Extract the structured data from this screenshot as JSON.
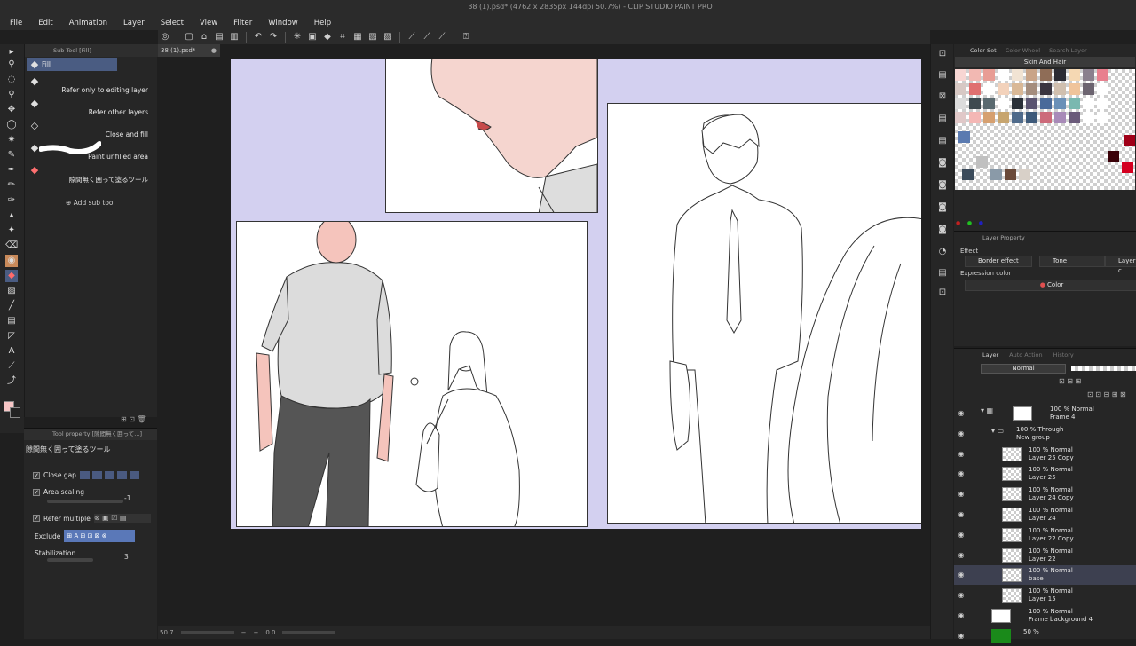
{
  "window": {
    "title": "38 (1).psd* (4762 x 2835px 144dpi 50.7%) - CLIP STUDIO PAINT PRO"
  },
  "menu": [
    "File",
    "Edit",
    "Animation",
    "Layer",
    "Select",
    "View",
    "Filter",
    "Window",
    "Help"
  ],
  "document_tab": {
    "label": "38 (1).psd*",
    "close": "●"
  },
  "subtool": {
    "header": "Sub Tool [Fill]",
    "items": [
      {
        "label": "Fill",
        "icon": "bucket-icon"
      },
      {
        "label": "Refer only to editing layer",
        "icon": "bucket-icon"
      },
      {
        "label": "Refer other layers",
        "icon": "bucket-icon"
      },
      {
        "label": "Close and fill",
        "icon": "bucket-icon"
      },
      {
        "label": "Paint unfilled area",
        "icon": "brush-stroke-icon"
      },
      {
        "label": "隙間無く囲って塗るツール",
        "icon": "colorful-bucket-icon"
      }
    ],
    "add_label": "Add sub tool"
  },
  "tool_property": {
    "header": "Tool property [隙間無く囲って...]",
    "title": "隙間無く囲って塗るツール",
    "close_gap": "Close gap",
    "area_scaling": "Area scaling",
    "area_scaling_value": "-1",
    "refer_multiple": "Refer multiple",
    "exclude": "Exclude",
    "stabilization": "Stabilization",
    "stabilization_value": "3"
  },
  "status": {
    "zoom": "50.7",
    "angle": "0.0"
  },
  "color_set": {
    "tabs": [
      "Color Set",
      "Color Wheel",
      "Search Layer"
    ],
    "title": "Skin And Hair",
    "swatches": [
      [
        "#f7d6d3",
        "#f2b8b2",
        "#e89d95",
        "#ffffff",
        "#f1e3d3",
        "#c9a488",
        "#8f6d57",
        "#2b2b33",
        "#f5d8b3",
        "#8a7f8d",
        "#e87f8e"
      ],
      [
        "#d7c8c4",
        "#e07070",
        "#ffffff",
        "#f3d2bb",
        "#d9b896",
        "#a48d7d",
        "#3a3540",
        "#d0bfae",
        "#f0c49b",
        "#6c6470",
        "#ffffff"
      ],
      [
        "#dcdcdc",
        "#3e4a50",
        "#5a6a70",
        "#ffffff",
        "#2a3038",
        "#5a5470",
        "#4a6a9a",
        "#6a90b8",
        "#7ab8b0",
        "#ffffff",
        "#ffffff"
      ],
      [
        "#e0c8c8",
        "#f4b7b5",
        "#d6a070",
        "#c7a56f",
        "#4f6a8a",
        "#3e5a7a",
        "#cc6a7a",
        "#a88ab8",
        "#6a5a7a",
        "#ffffff",
        "#ffffff"
      ]
    ],
    "extra": [
      {
        "color": "#5a7ab0"
      },
      {
        "color": "#c0c0c0"
      },
      {
        "color": "#3a4a5a"
      },
      {
        "color": "#8a9aa8"
      },
      {
        "color": "#6a4a3a"
      },
      {
        "color": "#d8d0c8"
      },
      {
        "color": "#a00018"
      },
      {
        "color": "#d40020"
      },
      {
        "color": "#3a0008"
      }
    ]
  },
  "layer_property": {
    "header": "Layer Property",
    "effect_label": "Effect",
    "border_effect": "Border effect",
    "tone": "Tone",
    "layer_color": "Layer c",
    "expression_label": "Expression color",
    "expression_value": "Color"
  },
  "layers": {
    "tabs": [
      "Layer",
      "Auto Action",
      "History"
    ],
    "blend_mode": "Normal",
    "rows": [
      {
        "line1": "100 % Normal",
        "line2": "Frame 4",
        "indent": 0,
        "type": "frame"
      },
      {
        "line1": "100 % Through",
        "line2": "New group",
        "indent": 1,
        "type": "folder"
      },
      {
        "line1": "100 % Normal",
        "line2": "Layer 25 Copy",
        "indent": 2,
        "type": "raster"
      },
      {
        "line1": "100 % Normal",
        "line2": "Layer 25",
        "indent": 2,
        "type": "raster"
      },
      {
        "line1": "100 % Normal",
        "line2": "Layer 24 Copy",
        "indent": 2,
        "type": "raster"
      },
      {
        "line1": "100 % Normal",
        "line2": "Layer 24",
        "indent": 2,
        "type": "raster"
      },
      {
        "line1": "100 % Normal",
        "line2": "Layer 22 Copy",
        "indent": 2,
        "type": "raster"
      },
      {
        "line1": "100 % Normal",
        "line2": "Layer 22",
        "indent": 2,
        "type": "raster"
      },
      {
        "line1": "100 % Normal",
        "line2": "base",
        "indent": 2,
        "type": "raster",
        "selected": true
      },
      {
        "line1": "100 % Normal",
        "line2": "Layer 15",
        "indent": 2,
        "type": "raster"
      },
      {
        "line1": "100 % Normal",
        "line2": "Frame background 4",
        "indent": 1,
        "type": "white"
      },
      {
        "line1": "50 %",
        "line2": "",
        "indent": 1,
        "type": "green"
      }
    ]
  }
}
